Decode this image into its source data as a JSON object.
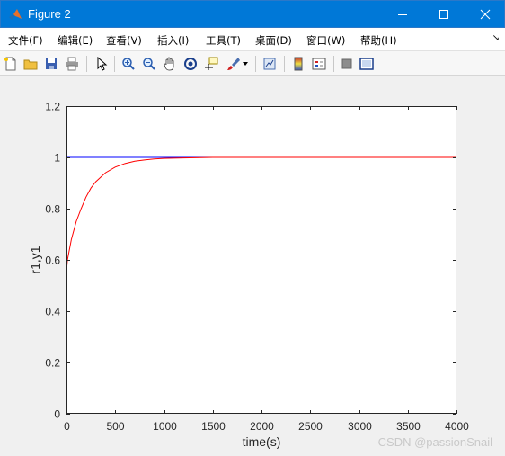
{
  "window": {
    "title": "Figure 2",
    "accent": "#0078d7"
  },
  "menu": {
    "items": [
      "文件(F)",
      "编辑(E)",
      "查看(V)",
      "插入(I)",
      "工具(T)",
      "桌面(D)",
      "窗口(W)",
      "帮助(H)"
    ]
  },
  "toolbar": {
    "icons": [
      "new-file-icon",
      "open-folder-icon",
      "save-icon",
      "print-icon",
      "pointer-icon",
      "zoom-in-icon",
      "zoom-out-icon",
      "pan-hand-icon",
      "rotate-3d-icon",
      "data-cursor-icon",
      "brush-icon",
      "brush-dropdown-icon",
      "link-plot-icon",
      "colorbar-icon",
      "legend-icon",
      "hide-plot-tools-icon",
      "show-plot-tools-icon"
    ]
  },
  "chart_data": {
    "type": "line",
    "xlabel": "time(s)",
    "ylabel": "r1,y1",
    "xlim": [
      0,
      4000
    ],
    "ylim": [
      0,
      1.2
    ],
    "xticks": [
      "0",
      "500",
      "1000",
      "1500",
      "2000",
      "2500",
      "3000",
      "3500",
      "4000"
    ],
    "yticks": [
      "0",
      "0.2",
      "0.4",
      "0.6",
      "0.8",
      "1",
      "1.2"
    ],
    "grid": false,
    "series": [
      {
        "color": "#0000ff",
        "x": [
          0,
          4000
        ],
        "y": [
          1,
          1
        ]
      },
      {
        "color": "#ff0000",
        "x": [
          0,
          1,
          3,
          10,
          25,
          50,
          100,
          150,
          200,
          250,
          300,
          400,
          500,
          600,
          700,
          800,
          900,
          1000,
          1200,
          1500,
          2000,
          2500,
          3000,
          3500,
          4000
        ],
        "y": [
          0,
          0.54,
          0.57,
          0.6,
          0.63,
          0.68,
          0.75,
          0.8,
          0.845,
          0.88,
          0.905,
          0.94,
          0.962,
          0.976,
          0.985,
          0.99,
          0.994,
          0.996,
          0.998,
          1.0,
          1.0,
          1.0,
          1.0,
          1.0,
          1.0
        ]
      }
    ]
  },
  "watermark": "CSDN @passionSnail"
}
